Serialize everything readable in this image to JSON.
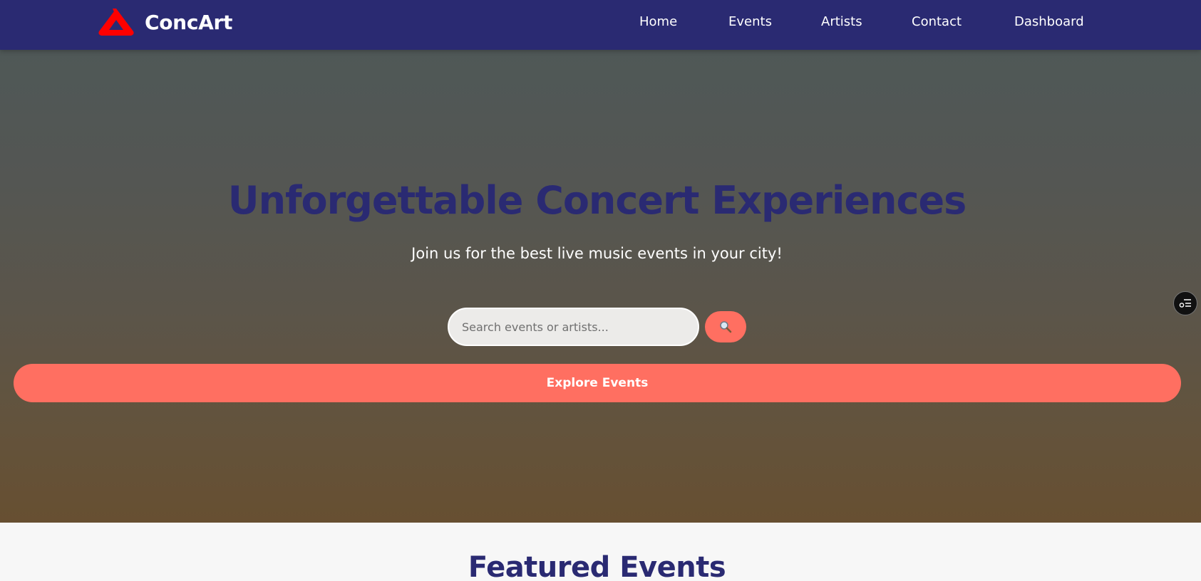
{
  "brand": {
    "name": "ConcArt",
    "logo_icon": "triangle-logo-icon",
    "logo_color": "#ff0000"
  },
  "nav": {
    "items": [
      {
        "label": "Home"
      },
      {
        "label": "Events"
      },
      {
        "label": "Artists"
      },
      {
        "label": "Contact"
      },
      {
        "label": "Dashboard"
      }
    ]
  },
  "hero": {
    "title": "Unforgettable Concert Experiences",
    "subtitle": "Join us for the best live music events in your city!",
    "search": {
      "placeholder": "Search events or artists...",
      "value": "",
      "button_icon": "search-icon"
    },
    "cta_label": "Explore Events"
  },
  "featured": {
    "title": "Featured Events"
  },
  "side_widget": {
    "icon": "settings-list-icon"
  },
  "colors": {
    "navbar": "#2a2a72",
    "accent": "#ff6f61",
    "title": "#2a2a72"
  }
}
